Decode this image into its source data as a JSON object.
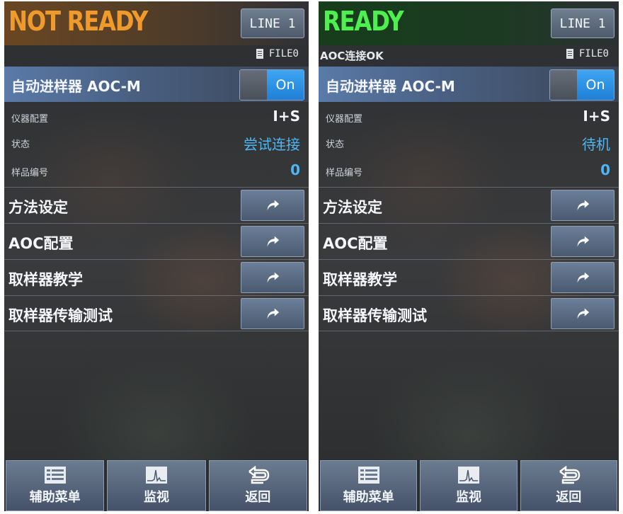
{
  "panels": [
    {
      "status_title": "NOT READY",
      "line_label": "LINE 1",
      "connection_message": "",
      "file_label": "FILE0",
      "sampler_label": "自动进样器 AOC-M",
      "toggle_label": "On",
      "info": [
        {
          "label": "仪器配置",
          "value": "I+S"
        },
        {
          "label": "状态",
          "value": "尝试连接"
        },
        {
          "label": "样品编号",
          "value": "0"
        }
      ],
      "menu": [
        {
          "label": "方法设定"
        },
        {
          "label": "AOC配置"
        },
        {
          "label": "取样器教学"
        },
        {
          "label": "取样器传输测试"
        }
      ],
      "bottom": [
        {
          "label": "辅助菜单",
          "icon": "list-icon"
        },
        {
          "label": "监视",
          "icon": "chromatogram-icon"
        },
        {
          "label": "返回",
          "icon": "return-icon"
        }
      ]
    },
    {
      "status_title": "READY",
      "line_label": "LINE 1",
      "connection_message": "AOC连接OK",
      "file_label": "FILE0",
      "sampler_label": "自动进样器 AOC-M",
      "toggle_label": "On",
      "info": [
        {
          "label": "仪器配置",
          "value": "I+S"
        },
        {
          "label": "状态",
          "value": "待机"
        },
        {
          "label": "样品编号",
          "value": "0"
        }
      ],
      "menu": [
        {
          "label": "方法设定"
        },
        {
          "label": "AOC配置"
        },
        {
          "label": "取样器教学"
        },
        {
          "label": "取样器传输测试"
        }
      ],
      "bottom": [
        {
          "label": "辅助菜单",
          "icon": "list-icon"
        },
        {
          "label": "监视",
          "icon": "chromatogram-icon"
        },
        {
          "label": "返回",
          "icon": "return-icon"
        }
      ]
    }
  ],
  "colors": {
    "not_ready": "#f09a2c",
    "ready": "#4ef050",
    "toggle_on": "#2a90e4",
    "accent_value": "#4fb6f4"
  }
}
